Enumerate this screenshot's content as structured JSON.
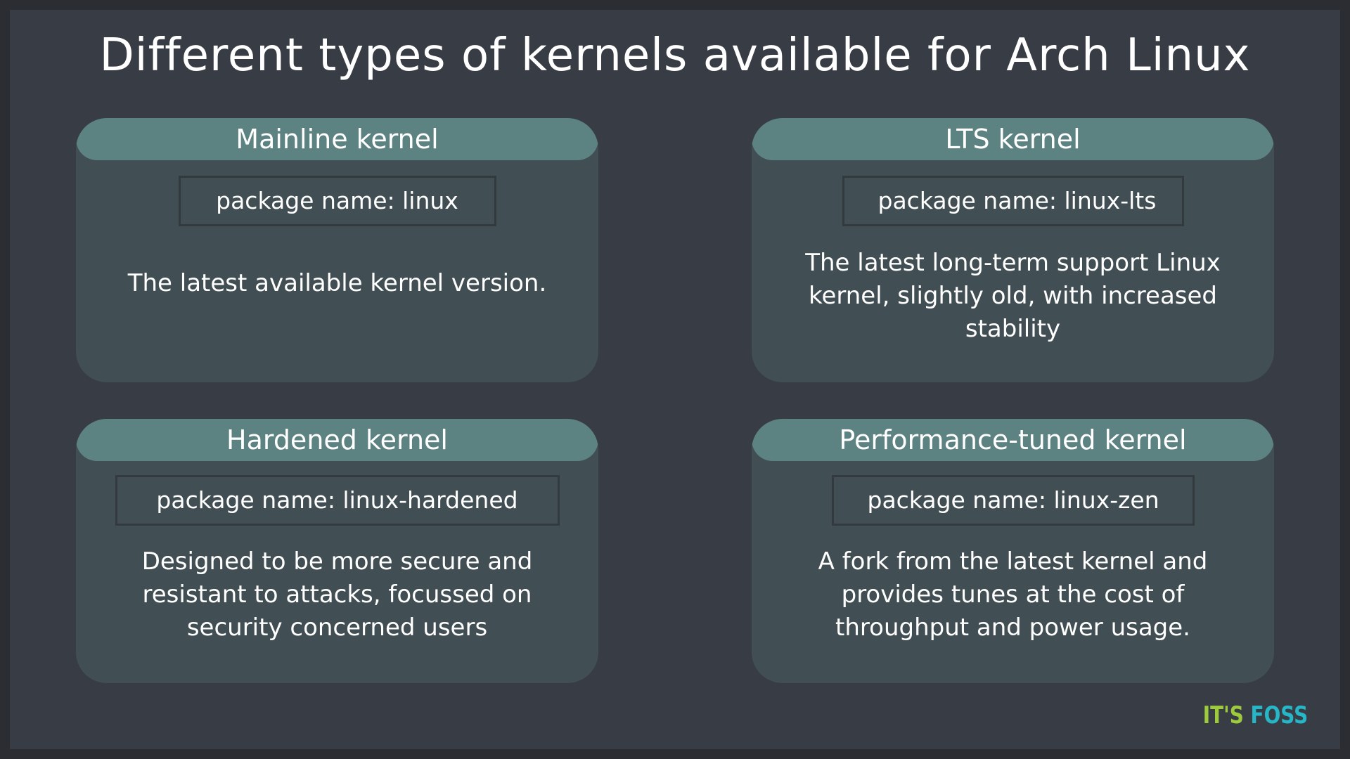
{
  "title": "Different types of kernels available for Arch Linux",
  "cards": [
    {
      "header": "Mainline kernel",
      "package": "package name: linux",
      "description": "The latest available kernel version."
    },
    {
      "header": "LTS kernel",
      "package": "package name: linux-lts",
      "description": "The latest long-term support Linux kernel, slightly old, with increased stability"
    },
    {
      "header": "Hardened kernel",
      "package": "package name: linux-hardened",
      "description": "Designed to be more secure and resistant to attacks, focussed on security concerned users"
    },
    {
      "header": "Performance-tuned kernel",
      "package": "package name: linux-zen",
      "description": "A fork from the latest kernel and provides tunes at the cost of throughput and power usage."
    }
  ],
  "logo": {
    "its": "IT'S",
    "foss": "FOSS"
  },
  "colors": {
    "background": "#383c44",
    "card": "#414e53",
    "header": "#5d8282",
    "logo_its": "#9ecb3c",
    "logo_foss": "#27b6c7"
  }
}
